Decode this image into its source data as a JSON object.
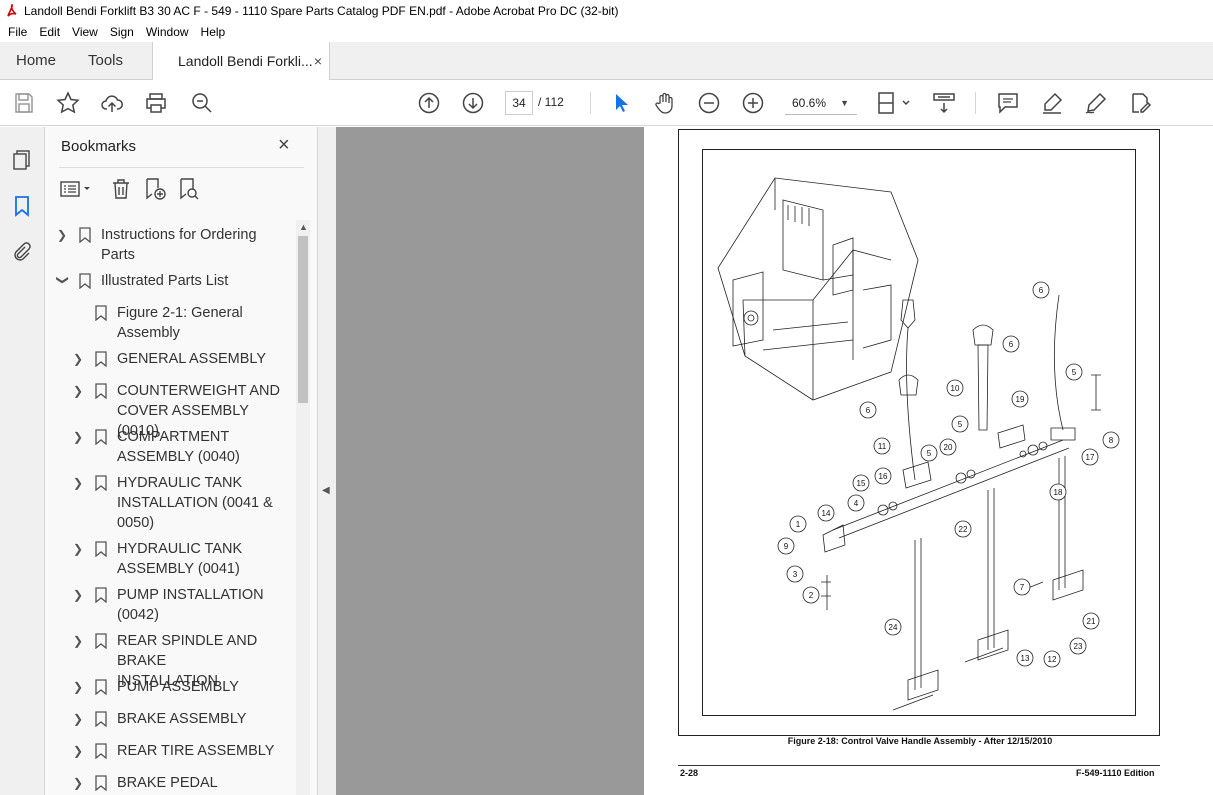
{
  "window": {
    "title": "Landoll Bendi Forklift B3 30 AC  F - 549 - 1110 Spare Parts Catalog PDF EN.pdf - Adobe Acrobat Pro DC (32-bit)"
  },
  "menu": [
    "File",
    "Edit",
    "View",
    "Sign",
    "Window",
    "Help"
  ],
  "tabs": {
    "home": "Home",
    "tools": "Tools",
    "document": "Landoll Bendi Forkli...",
    "close": "×"
  },
  "toolbar": {
    "page_current": "34",
    "page_total": "/ 112",
    "zoom": "60.6%"
  },
  "bookmarks": {
    "title": "Bookmarks",
    "close": "×",
    "items": [
      {
        "label": "Instructions for Ordering Parts",
        "level": 0,
        "expand": "collapsed"
      },
      {
        "label": "Illustrated Parts List",
        "level": 0,
        "expand": "expanded"
      },
      {
        "label": "Figure 2-1: General Assembly",
        "level": 1,
        "expand": "none"
      },
      {
        "label": "GENERAL ASSEMBLY",
        "level": 1,
        "expand": "collapsed"
      },
      {
        "label": "COUNTERWEIGHT AND COVER ASSEMBLY (0010)",
        "level": 1,
        "expand": "collapsed"
      },
      {
        "label": "COMPARTMENT ASSEMBLY (0040)",
        "level": 1,
        "expand": "collapsed"
      },
      {
        "label": "HYDRAULIC TANK INSTALLATION (0041 & 0050)",
        "level": 1,
        "expand": "collapsed"
      },
      {
        "label": "HYDRAULIC TANK ASSEMBLY (0041)",
        "level": 1,
        "expand": "collapsed"
      },
      {
        "label": "PUMP INSTALLATION (0042)",
        "level": 1,
        "expand": "collapsed"
      },
      {
        "label": "REAR SPINDLE AND BRAKE INSTALLATION",
        "level": 1,
        "expand": "collapsed"
      },
      {
        "label": "PUMP ASSEMBLY",
        "level": 1,
        "expand": "collapsed"
      },
      {
        "label": "BRAKE ASSEMBLY",
        "level": 1,
        "expand": "collapsed"
      },
      {
        "label": "REAR TIRE ASSEMBLY",
        "level": 1,
        "expand": "collapsed"
      },
      {
        "label": "BRAKE PEDAL",
        "level": 1,
        "expand": "collapsed"
      }
    ]
  },
  "document": {
    "caption": "Figure 2-18:  Control Valve Handle Assembly - After 12/15/2010",
    "footer_left": "2-28",
    "footer_right": "F-549-1110 Edition",
    "callouts": [
      "6",
      "6",
      "5",
      "10",
      "6",
      "19",
      "5",
      "8",
      "11",
      "20",
      "17",
      "5",
      "15",
      "16",
      "18",
      "4",
      "14",
      "22",
      "1",
      "9",
      "3",
      "2",
      "7",
      "24",
      "21",
      "13",
      "12",
      "23"
    ]
  },
  "colors": {
    "accent": "#1473e6",
    "chrome": "#f0f0f0",
    "viewer_bg": "#999999"
  }
}
